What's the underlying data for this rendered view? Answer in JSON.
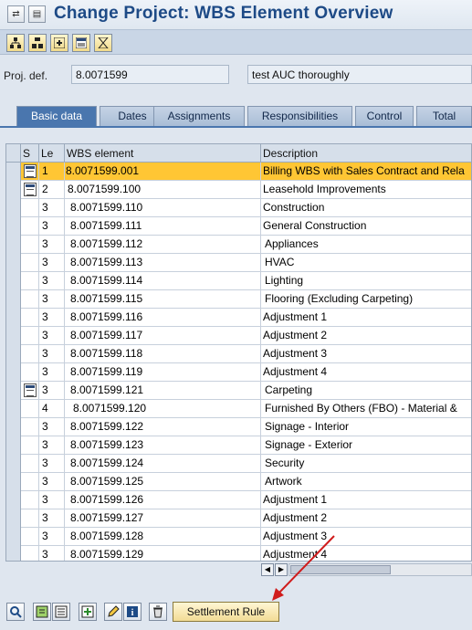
{
  "title": "Change Project: WBS Element Overview",
  "toolbar_icons": [
    "hierarchy-icon",
    "structure-icon",
    "insert-icon",
    "details-icon",
    "hourglass-icon"
  ],
  "project": {
    "label": "Proj. def.",
    "value": "8.0071599",
    "description": "test AUC thoroughly"
  },
  "tabs": [
    "Basic data",
    "Dates",
    "Assignments",
    "Responsibilities",
    "Control",
    "Total"
  ],
  "active_tab": "Basic data",
  "columns": [
    "S",
    "Le",
    "WBS element",
    "Description"
  ],
  "rows": [
    {
      "icon": true,
      "level": "1",
      "wbs": "8.0071599.001",
      "desc": "Billing WBS with Sales Contract and Rela"
    },
    {
      "icon": true,
      "level": "2",
      "wbs": "8.0071599.100",
      "desc": "Leasehold Improvements"
    },
    {
      "icon": false,
      "level": "3",
      "wbs": "8.0071599.110",
      "desc": "Construction"
    },
    {
      "icon": false,
      "level": "3",
      "wbs": "8.0071599.111",
      "desc": "General Construction"
    },
    {
      "icon": false,
      "level": "3",
      "wbs": "8.0071599.112",
      "desc": "Appliances"
    },
    {
      "icon": false,
      "level": "3",
      "wbs": "8.0071599.113",
      "desc": "HVAC"
    },
    {
      "icon": false,
      "level": "3",
      "wbs": "8.0071599.114",
      "desc": "Lighting"
    },
    {
      "icon": false,
      "level": "3",
      "wbs": "8.0071599.115",
      "desc": "Flooring (Excluding Carpeting)"
    },
    {
      "icon": false,
      "level": "3",
      "wbs": "8.0071599.116",
      "desc": "Adjustment 1"
    },
    {
      "icon": false,
      "level": "3",
      "wbs": "8.0071599.117",
      "desc": "Adjustment 2"
    },
    {
      "icon": false,
      "level": "3",
      "wbs": "8.0071599.118",
      "desc": "Adjustment 3"
    },
    {
      "icon": false,
      "level": "3",
      "wbs": "8.0071599.119",
      "desc": "Adjustment 4"
    },
    {
      "icon": true,
      "level": "3",
      "wbs": "8.0071599.121",
      "desc": "Carpeting"
    },
    {
      "icon": false,
      "level": "4",
      "wbs": "8.0071599.120",
      "desc": "Furnished By Others (FBO) - Material &"
    },
    {
      "icon": false,
      "level": "3",
      "wbs": "8.0071599.122",
      "desc": "Signage - Interior"
    },
    {
      "icon": false,
      "level": "3",
      "wbs": "8.0071599.123",
      "desc": "Signage - Exterior"
    },
    {
      "icon": false,
      "level": "3",
      "wbs": "8.0071599.124",
      "desc": "Security"
    },
    {
      "icon": false,
      "level": "3",
      "wbs": "8.0071599.125",
      "desc": "Artwork"
    },
    {
      "icon": false,
      "level": "3",
      "wbs": "8.0071599.126",
      "desc": "Adjustment 1"
    },
    {
      "icon": false,
      "level": "3",
      "wbs": "8.0071599.127",
      "desc": "Adjustment 2"
    },
    {
      "icon": false,
      "level": "3",
      "wbs": "8.0071599.128",
      "desc": "Adjustment 3"
    },
    {
      "icon": false,
      "level": "3",
      "wbs": "8.0071599.129",
      "desc": "Adjustment 4"
    }
  ],
  "selected_row": 0,
  "bottom_icons": [
    "magnifier-icon",
    "export-icon",
    "print-icon",
    "add-row-icon",
    "edit-icon",
    "info-icon",
    "trash-icon"
  ],
  "settlement_button": "Settlement Rule",
  "colors": {
    "title": "#1d4a86",
    "selected_row": "#ffc634",
    "active_tab": "#4a76ae",
    "annotation_arrow": "#d01c1c"
  }
}
